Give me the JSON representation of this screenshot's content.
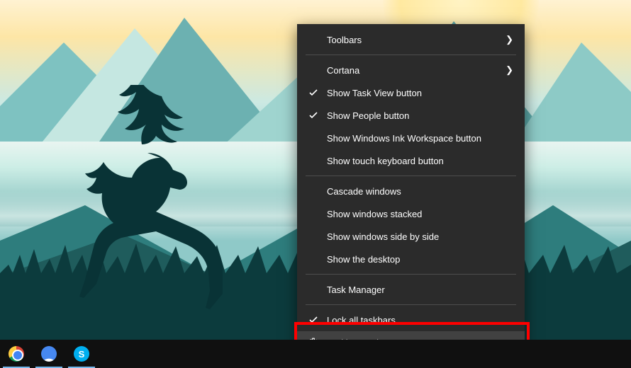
{
  "context_menu": {
    "items": [
      {
        "label": "Toolbars",
        "submenu": true,
        "checked": false,
        "icon": null
      },
      {
        "sep": true
      },
      {
        "label": "Cortana",
        "submenu": true,
        "checked": false,
        "icon": null
      },
      {
        "label": "Show Task View button",
        "submenu": false,
        "checked": true,
        "icon": null
      },
      {
        "label": "Show People button",
        "submenu": false,
        "checked": true,
        "icon": null
      },
      {
        "label": "Show Windows Ink Workspace button",
        "submenu": false,
        "checked": false,
        "icon": null
      },
      {
        "label": "Show touch keyboard button",
        "submenu": false,
        "checked": false,
        "icon": null
      },
      {
        "sep": true
      },
      {
        "label": "Cascade windows",
        "submenu": false,
        "checked": false,
        "icon": null
      },
      {
        "label": "Show windows stacked",
        "submenu": false,
        "checked": false,
        "icon": null
      },
      {
        "label": "Show windows side by side",
        "submenu": false,
        "checked": false,
        "icon": null
      },
      {
        "label": "Show the desktop",
        "submenu": false,
        "checked": false,
        "icon": null
      },
      {
        "sep": true
      },
      {
        "label": "Task Manager",
        "submenu": false,
        "checked": false,
        "icon": null
      },
      {
        "sep": true
      },
      {
        "label": "Lock all taskbars",
        "submenu": false,
        "checked": true,
        "icon": null
      },
      {
        "label": "Taskbar settings",
        "submenu": false,
        "checked": false,
        "icon": "gear",
        "hover": true
      }
    ]
  },
  "taskbar": {
    "pinned": [
      {
        "name": "google-chrome",
        "running": true
      },
      {
        "name": "nordvpn",
        "running": true
      },
      {
        "name": "skype",
        "running": true
      }
    ]
  },
  "annotation": {
    "highlight_target": "taskbar-settings"
  },
  "colors": {
    "menu_bg": "#2b2b2b",
    "menu_hover": "#414141",
    "highlight": "#ff0000"
  }
}
